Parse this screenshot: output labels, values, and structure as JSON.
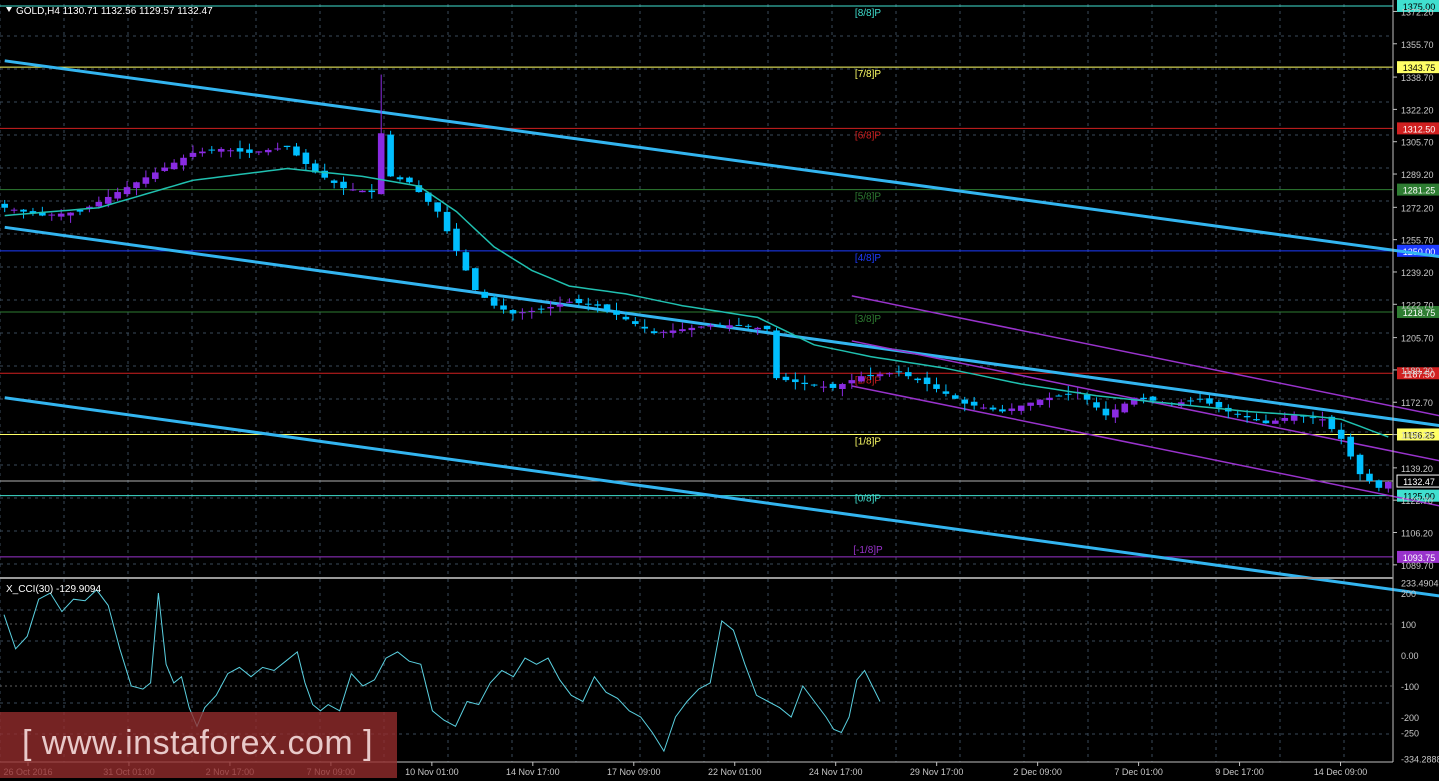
{
  "header": {
    "symbol_label": "GOLD,H4  1130.71 1132.56 1129.57 1132.47"
  },
  "indicator": {
    "label": "X_CCI(30) -129.9094"
  },
  "watermark": {
    "text": "[ www.instaforex.com ]"
  },
  "colors": {
    "background": "#000000",
    "grid": "#3a4a5a",
    "bull_candle": "#8a2be2",
    "bear_candle": "#00bfff",
    "moving_average": "#20c0b0",
    "wide_channel": "#33b5f0",
    "narrow_channel": "#9933cc",
    "cci_line": "#5ad0e0"
  },
  "chart_data": [
    {
      "type": "candlestick",
      "title": "GOLD,H4",
      "ylim": [
        1084,
        1376
      ],
      "y_ticks": [
        "1372.20",
        "1355.70",
        "1338.70",
        "1322.20",
        "1305.70",
        "1289.20",
        "1272.20",
        "1255.70",
        "1239.20",
        "1222.70",
        "1205.70",
        "1189.20",
        "1172.70",
        "1156.20",
        "1139.20",
        "1122.70",
        "1106.20",
        "1089.70"
      ],
      "x_tick_labels": [
        "26 Oct 2016",
        "31 Oct 01:00",
        "2 Nov 17:00",
        "7 Nov 09:00",
        "10 Nov 01:00",
        "14 Nov 17:00",
        "17 Nov 09:00",
        "22 Nov 01:00",
        "24 Nov 17:00",
        "29 Nov 17:00",
        "2 Dec 09:00",
        "7 Dec 01:00",
        "9 Dec 17:00",
        "14 Dec 09:00"
      ],
      "current_price": {
        "value": 1132.47,
        "label": "1132.47"
      },
      "murrey_levels": [
        {
          "label": "[8/8]P",
          "value": 1375.0,
          "price_label": "1375.00",
          "color": "#40e0d0"
        },
        {
          "label": "[7/8]P",
          "value": 1343.75,
          "price_label": "1343.75",
          "color": "#ffff66"
        },
        {
          "label": "[6/8]P",
          "value": 1312.5,
          "price_label": "1312.50",
          "color": "#d02020"
        },
        {
          "label": "[5/8]P",
          "value": 1281.25,
          "price_label": "1281.25",
          "color": "#2e7d32"
        },
        {
          "label": "[4/8]P",
          "value": 1250.0,
          "price_label": "1250.00",
          "color": "#1e3cff"
        },
        {
          "label": "[3/8]P",
          "value": 1218.75,
          "price_label": "1218.75",
          "color": "#2e7d32"
        },
        {
          "label": "[2/8]P",
          "value": 1187.5,
          "price_label": "1187.50",
          "color": "#d02020"
        },
        {
          "label": "[1/8]P",
          "value": 1156.25,
          "price_label": "1156.25",
          "color": "#ffff66"
        },
        {
          "label": "[0/8]P",
          "value": 1125.0,
          "price_label": "1125.00",
          "color": "#40e0d0"
        },
        {
          "label": "[-1/8]P",
          "value": 1093.75,
          "price_label": "1093.75",
          "color": "#9933cc"
        }
      ],
      "wide_channel": [
        {
          "start": [
            0,
            1347
          ],
          "end": [
            238,
            1191
          ]
        },
        {
          "start": [
            0,
            1262
          ],
          "end": [
            238,
            1104
          ]
        },
        {
          "start": [
            0,
            1175
          ],
          "end": [
            238,
            1017
          ]
        }
      ],
      "narrow_channel": [
        {
          "start": [
            90,
            1227
          ],
          "end": [
            238,
            1082
          ]
        },
        {
          "start": [
            90,
            1204
          ],
          "end": [
            238,
            1059
          ]
        },
        {
          "start": [
            90,
            1181
          ],
          "end": [
            238,
            1036
          ]
        }
      ],
      "close_path_keypoints": [
        [
          0,
          1272
        ],
        [
          4,
          1268
        ],
        [
          8,
          1270
        ],
        [
          12,
          1280
        ],
        [
          16,
          1290
        ],
        [
          20,
          1300
        ],
        [
          23,
          1302
        ],
        [
          26,
          1300
        ],
        [
          30,
          1303
        ],
        [
          33,
          1290
        ],
        [
          36,
          1282
        ],
        [
          39,
          1280
        ],
        [
          40,
          1310
        ],
        [
          41,
          1288
        ],
        [
          43,
          1285
        ],
        [
          46,
          1270
        ],
        [
          48,
          1250
        ],
        [
          50,
          1230
        ],
        [
          52,
          1222
        ],
        [
          54,
          1218
        ],
        [
          57,
          1220
        ],
        [
          60,
          1224
        ],
        [
          63,
          1222
        ],
        [
          66,
          1215
        ],
        [
          69,
          1208
        ],
        [
          72,
          1210
        ],
        [
          75,
          1212
        ],
        [
          78,
          1212
        ],
        [
          81,
          1210
        ],
        [
          82,
          1185
        ],
        [
          85,
          1182
        ],
        [
          88,
          1180
        ],
        [
          91,
          1186
        ],
        [
          95,
          1188
        ],
        [
          98,
          1182
        ],
        [
          102,
          1172
        ],
        [
          106,
          1168
        ],
        [
          110,
          1174
        ],
        [
          114,
          1178
        ],
        [
          117,
          1166
        ],
        [
          120,
          1175
        ],
        [
          124,
          1172
        ],
        [
          127,
          1174
        ],
        [
          130,
          1168
        ],
        [
          134,
          1162
        ],
        [
          137,
          1166
        ],
        [
          140,
          1164
        ],
        [
          142,
          1154
        ],
        [
          144,
          1136
        ],
        [
          146,
          1129
        ],
        [
          147,
          1132
        ]
      ],
      "ma_keypoints": [
        [
          0,
          1268
        ],
        [
          10,
          1272
        ],
        [
          20,
          1286
        ],
        [
          30,
          1292
        ],
        [
          38,
          1288
        ],
        [
          44,
          1283
        ],
        [
          48,
          1270
        ],
        [
          52,
          1252
        ],
        [
          56,
          1240
        ],
        [
          60,
          1232
        ],
        [
          66,
          1228
        ],
        [
          72,
          1222
        ],
        [
          80,
          1216
        ],
        [
          86,
          1202
        ],
        [
          92,
          1196
        ],
        [
          100,
          1190
        ],
        [
          108,
          1182
        ],
        [
          116,
          1176
        ],
        [
          124,
          1172
        ],
        [
          132,
          1168
        ],
        [
          138,
          1166
        ],
        [
          142,
          1164
        ],
        [
          147,
          1155
        ]
      ]
    },
    {
      "type": "line",
      "title": "X_CCI(30) -129.9094",
      "ylim": [
        -345,
        245
      ],
      "y_ticks": [
        "233.4904",
        "200",
        "100",
        "0.00",
        "-100",
        "-200",
        "-250",
        "-334.2888"
      ],
      "keypoints": [
        [
          0,
          130
        ],
        [
          3,
          20
        ],
        [
          6,
          60
        ],
        [
          9,
          180
        ],
        [
          12,
          200
        ],
        [
          15,
          140
        ],
        [
          18,
          180
        ],
        [
          21,
          175
        ],
        [
          24,
          210
        ],
        [
          27,
          160
        ],
        [
          30,
          20
        ],
        [
          33,
          -100
        ],
        [
          36,
          -110
        ],
        [
          38,
          -90
        ],
        [
          40,
          200
        ],
        [
          42,
          -30
        ],
        [
          44,
          -90
        ],
        [
          46,
          -70
        ],
        [
          48,
          -170
        ],
        [
          50,
          -230
        ],
        [
          52,
          -170
        ],
        [
          55,
          -130
        ],
        [
          58,
          -60
        ],
        [
          61,
          -40
        ],
        [
          64,
          -70
        ],
        [
          67,
          -40
        ],
        [
          70,
          -50
        ],
        [
          73,
          -20
        ],
        [
          76,
          10
        ],
        [
          78,
          -90
        ],
        [
          80,
          -160
        ],
        [
          82,
          -180
        ],
        [
          84,
          -160
        ],
        [
          87,
          -180
        ],
        [
          90,
          -60
        ],
        [
          93,
          -100
        ],
        [
          96,
          -80
        ],
        [
          99,
          -10
        ],
        [
          102,
          10
        ],
        [
          105,
          -20
        ],
        [
          108,
          -30
        ],
        [
          111,
          -180
        ],
        [
          114,
          -210
        ],
        [
          117,
          -230
        ],
        [
          120,
          -150
        ],
        [
          123,
          -160
        ],
        [
          126,
          -90
        ],
        [
          129,
          -50
        ],
        [
          132,
          -70
        ],
        [
          135,
          -10
        ],
        [
          138,
          -30
        ],
        [
          141,
          -10
        ],
        [
          144,
          -80
        ],
        [
          147,
          -130
        ],
        [
          150,
          -150
        ],
        [
          153,
          -70
        ],
        [
          156,
          -120
        ],
        [
          159,
          -140
        ],
        [
          162,
          -180
        ],
        [
          165,
          -200
        ],
        [
          168,
          -250
        ],
        [
          171,
          -310
        ],
        [
          174,
          -200
        ],
        [
          177,
          -150
        ],
        [
          180,
          -110
        ],
        [
          183,
          -90
        ],
        [
          186,
          110
        ],
        [
          189,
          80
        ],
        [
          192,
          -30
        ],
        [
          195,
          -130
        ],
        [
          198,
          -150
        ],
        [
          201,
          -170
        ],
        [
          204,
          -200
        ],
        [
          207,
          -100
        ],
        [
          210,
          -150
        ],
        [
          213,
          -200
        ],
        [
          215,
          -240
        ],
        [
          217,
          -250
        ],
        [
          219,
          -200
        ],
        [
          221,
          -80
        ],
        [
          223,
          -50
        ],
        [
          225,
          -100
        ],
        [
          227,
          -150
        ]
      ],
      "keypoints_x_scale": [
        0,
        227
      ]
    }
  ]
}
